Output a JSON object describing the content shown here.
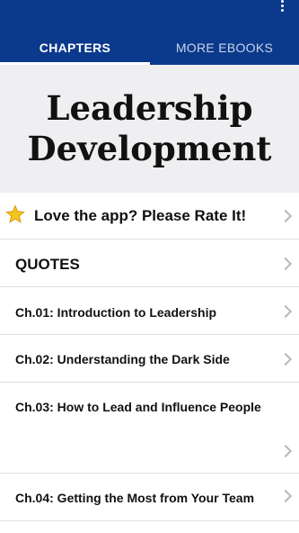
{
  "appbar": {
    "tabs": [
      {
        "label": "CHAPTERS",
        "active": true
      },
      {
        "label": "MORE EBOOKS",
        "active": false
      }
    ],
    "overflow_icon": "more-vertical-icon",
    "color": "#0b3a8c"
  },
  "hero": {
    "title_line1": "Leadership",
    "title_line2": "Development"
  },
  "list": {
    "rate": "Love the app? Please Rate It!",
    "quotes": "QUOTES",
    "chapters": [
      "Ch.01: Introduction to Leadership",
      "Ch.02: Understanding the Dark Side",
      "Ch.03: How to Lead and Influence People",
      "Ch.04: Getting the Most from Your Team"
    ]
  }
}
